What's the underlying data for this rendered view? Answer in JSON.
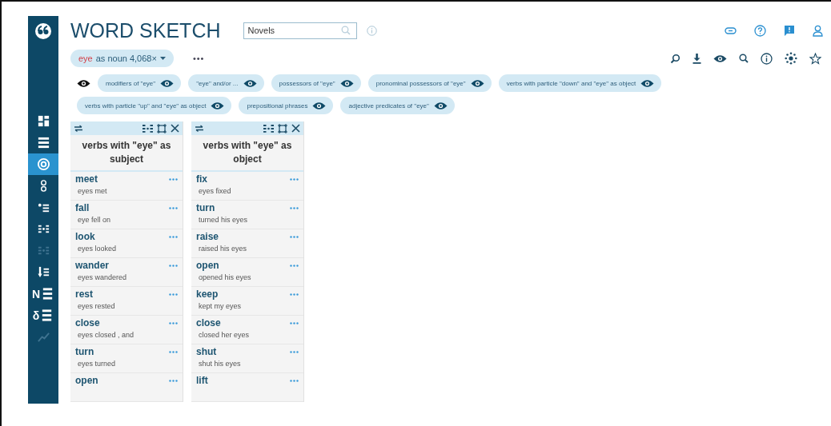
{
  "sidebar": {
    "items": [
      {
        "kind": "dashboard",
        "selected": false,
        "disabled": false
      },
      {
        "kind": "list",
        "selected": false,
        "disabled": false
      },
      {
        "kind": "target",
        "selected": true,
        "disabled": false
      },
      {
        "kind": "rings",
        "selected": false,
        "disabled": false
      },
      {
        "kind": "bullets",
        "selected": false,
        "disabled": false
      },
      {
        "kind": "dotlist",
        "selected": false,
        "disabled": false
      },
      {
        "kind": "dotgrid",
        "selected": false,
        "disabled": true
      },
      {
        "kind": "sortlist",
        "selected": false,
        "disabled": false
      },
      {
        "kind": "letterlist",
        "label": "N",
        "selected": false,
        "disabled": false
      },
      {
        "kind": "letterlist",
        "label": "δ",
        "selected": false,
        "disabled": false
      },
      {
        "kind": "trend",
        "selected": false,
        "disabled": true
      }
    ]
  },
  "header": {
    "title": "WORD SKETCH",
    "corpus_field": {
      "value": "Novels"
    }
  },
  "query": {
    "lemma": "eye",
    "rest": "as noun 4,068×",
    "more": "•••"
  },
  "relations": [
    {
      "label": "modifiers of \"eye\""
    },
    {
      "label": "\"eye\" and/or ..."
    },
    {
      "label": "possessors of \"eye\""
    },
    {
      "label": "pronominal possessors of \"eye\""
    },
    {
      "label": "verbs with particle \"down\" and \"eye\" as object"
    },
    {
      "label": "verbs with particle \"up\" and \"eye\" as object"
    },
    {
      "label": "prepositional phrases"
    },
    {
      "label": "adjective predicates of \"eye\""
    }
  ],
  "columns": [
    {
      "title": "verbs with \"eye\" as subject",
      "rows": [
        {
          "word": "meet",
          "example": "eyes met"
        },
        {
          "word": "fall",
          "example": "eye fell on"
        },
        {
          "word": "look",
          "example": "eyes looked"
        },
        {
          "word": "wander",
          "example": "eyes wandered"
        },
        {
          "word": "rest",
          "example": "eyes rested"
        },
        {
          "word": "close",
          "example": "eyes closed , and"
        },
        {
          "word": "turn",
          "example": "eyes turned"
        },
        {
          "word": "open"
        }
      ]
    },
    {
      "title": "verbs with \"eye\" as object",
      "rows": [
        {
          "word": "fix",
          "example": "eyes fixed"
        },
        {
          "word": "turn",
          "example": "turned his eyes"
        },
        {
          "word": "raise",
          "example": "raised his eyes"
        },
        {
          "word": "open",
          "example": "opened his eyes"
        },
        {
          "word": "keep",
          "example": "kept my eyes"
        },
        {
          "word": "close",
          "example": "closed her eyes"
        },
        {
          "word": "shut",
          "example": "shut his eyes"
        },
        {
          "word": "lift"
        }
      ]
    }
  ]
}
